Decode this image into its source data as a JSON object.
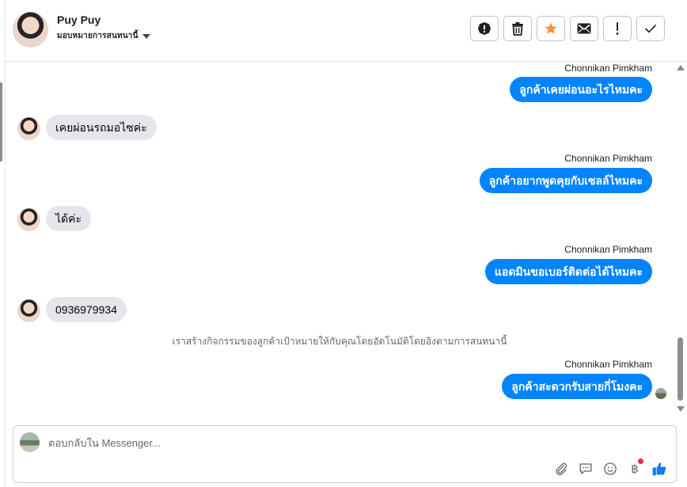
{
  "header": {
    "contact_name": "Puy Puy",
    "assign_label": "มอบหมายการสนทนานี้"
  },
  "toolbar": {
    "buttons": [
      {
        "name": "report-spam",
        "icon": "exclamation-circle-icon"
      },
      {
        "name": "delete",
        "icon": "trash-icon"
      },
      {
        "name": "star",
        "icon": "star-icon",
        "color": "#f7923b"
      },
      {
        "name": "mark-unread",
        "icon": "envelope-icon"
      },
      {
        "name": "follow-up",
        "icon": "exclamation-icon"
      },
      {
        "name": "mark-done",
        "icon": "checkmark-icon"
      }
    ]
  },
  "messages": [
    {
      "direction": "out",
      "sender": "Chonnikan Pimkham",
      "text": "ลูกค้าเคยผ่อนอะไรไหมคะ"
    },
    {
      "direction": "in",
      "text": "เคยผ่อนรถมอไซค่ะ"
    },
    {
      "direction": "out",
      "sender": "Chonnikan Pimkham",
      "text": "ลูกค้าอยากพูดคุยกับเซลล์ไหมคะ"
    },
    {
      "direction": "in",
      "text": "ได้ค่ะ"
    },
    {
      "direction": "out",
      "sender": "Chonnikan Pimkham",
      "text": "แอดมินขอเบอร์ติดต่อได้ไหมคะ"
    },
    {
      "direction": "in",
      "text": "0936979934"
    },
    {
      "direction": "system",
      "text": "เราสร้างกิจกรรมของลูกค้าเป้าหมายให้กับคุณโดยอัตโนมัติโดยอิงตามการสนทนานี้"
    },
    {
      "direction": "out",
      "sender": "Chonnikan Pimkham",
      "text": "ลูกค้าสะดวกรับสายกี่โมงคะ"
    }
  ],
  "composer": {
    "placeholder": "ตอบกลับใน Messenger...",
    "icons": [
      "paperclip-icon",
      "saved-reply-icon",
      "emoji-icon",
      "baht-payment-icon",
      "thumbs-up-icon"
    ]
  },
  "colors": {
    "outgoing_bubble": "#0084ff",
    "incoming_bubble": "#e4e6eb",
    "star": "#f7923b",
    "like": "#1877f2",
    "notification_dot": "#f02849"
  }
}
